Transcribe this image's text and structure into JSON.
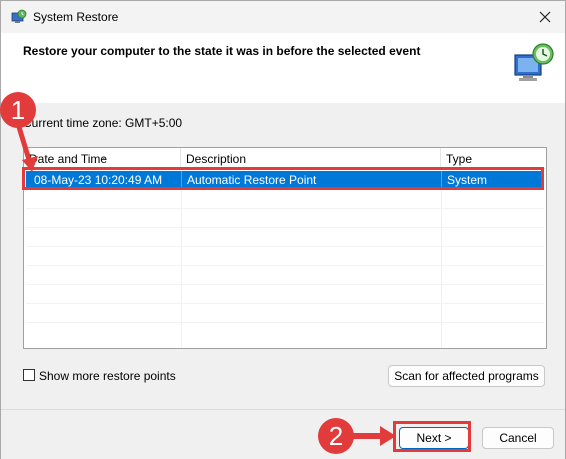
{
  "window": {
    "title": "System Restore"
  },
  "header": {
    "heading": "Restore your computer to the state it was in before the selected event"
  },
  "timezone": {
    "label": "Current time zone: GMT+5:00"
  },
  "list": {
    "columns": [
      "Date and Time",
      "Description",
      "Type"
    ],
    "rows": [
      {
        "date": "08-May-23 10:20:49 AM",
        "description": "Automatic Restore Point",
        "type": "System",
        "selected": true
      }
    ]
  },
  "options": {
    "show_more_label": "Show more restore points",
    "show_more_checked": false
  },
  "buttons": {
    "scan": "Scan for affected programs",
    "next": "Next >",
    "cancel": "Cancel"
  },
  "annotations": {
    "step1": "1",
    "step2": "2",
    "color": "#e23b3b"
  },
  "colors": {
    "selection": "#0078d7"
  },
  "icons": {
    "title": "system-restore-icon",
    "header": "restore-monitor-clock-icon",
    "close": "close-icon"
  }
}
